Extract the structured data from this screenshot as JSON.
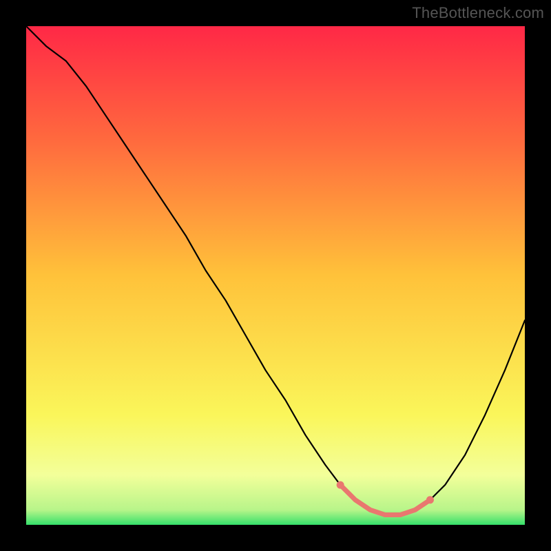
{
  "watermark": "TheBottleneck.com",
  "colors": {
    "background": "#000000",
    "curve_stroke": "#000000",
    "highlight_stroke": "#E9776F",
    "highlight_dot_fill": "#E9776F",
    "gradient_top": "#FF2846",
    "gradient_mid_upper": "#FF8A3A",
    "gradient_mid": "#FFD53A",
    "gradient_mid_lower": "#FAFF6A",
    "gradient_lower": "#EFFFA6",
    "gradient_bottom": "#35E06A"
  },
  "chart_data": {
    "type": "line",
    "title": "",
    "xlabel": "",
    "ylabel": "",
    "xlim": [
      0,
      100
    ],
    "ylim": [
      0,
      100
    ],
    "series": [
      {
        "name": "bottleneck-curve",
        "x": [
          0,
          4,
          8,
          12,
          16,
          20,
          24,
          28,
          32,
          36,
          40,
          44,
          48,
          52,
          56,
          60,
          63,
          66,
          69,
          72,
          75,
          78,
          81,
          84,
          88,
          92,
          96,
          100
        ],
        "y": [
          100,
          96,
          93,
          88,
          82,
          76,
          70,
          64,
          58,
          51,
          45,
          38,
          31,
          25,
          18,
          12,
          8,
          5,
          3,
          2,
          2,
          3,
          5,
          8,
          14,
          22,
          31,
          41
        ]
      }
    ],
    "highlight_segment": {
      "series": "bottleneck-curve",
      "x": [
        63,
        66,
        69,
        72,
        75,
        78,
        81
      ],
      "y": [
        8,
        5,
        3,
        2,
        2,
        3,
        5
      ]
    },
    "gradient_stops_pct": [
      0,
      23,
      50,
      78,
      90,
      97,
      100
    ]
  }
}
